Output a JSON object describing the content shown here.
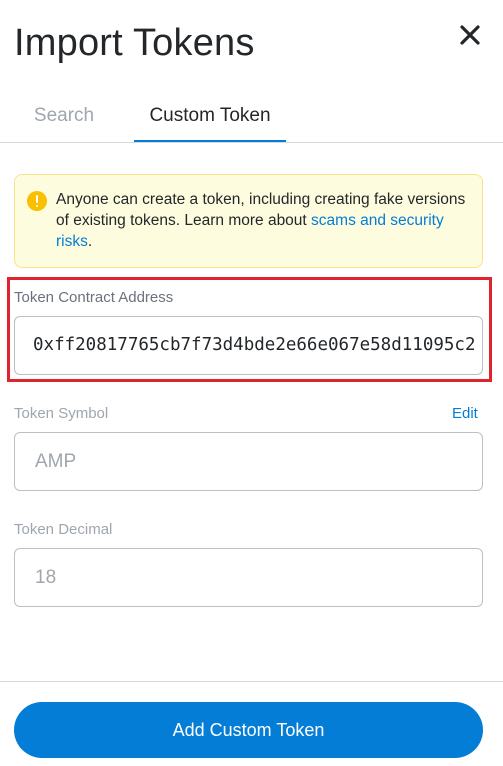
{
  "header": {
    "title": "Import Tokens",
    "close_icon": "close-icon"
  },
  "tabs": [
    {
      "label": "Search",
      "active": false
    },
    {
      "label": "Custom Token",
      "active": true
    }
  ],
  "warning": {
    "icon": "info-icon",
    "text_before": "Anyone can create a token, including creating fake versions of existing tokens. Learn more about ",
    "link_text": "scams and security risks",
    "text_after": "."
  },
  "form": {
    "address_label": "Token Contract Address",
    "address_value": "0xff20817765cb7f73d4bde2e66e067e58d11095c2",
    "symbol_label": "Token Symbol",
    "symbol_edit": "Edit",
    "symbol_value": "AMP",
    "decimal_label": "Token Decimal",
    "decimal_value": "18"
  },
  "footer": {
    "add_button": "Add Custom Token"
  },
  "colors": {
    "accent": "#037dd6",
    "highlight": "#e0242f",
    "warning_bg": "#fefcde",
    "warning_icon": "#f8c000"
  }
}
